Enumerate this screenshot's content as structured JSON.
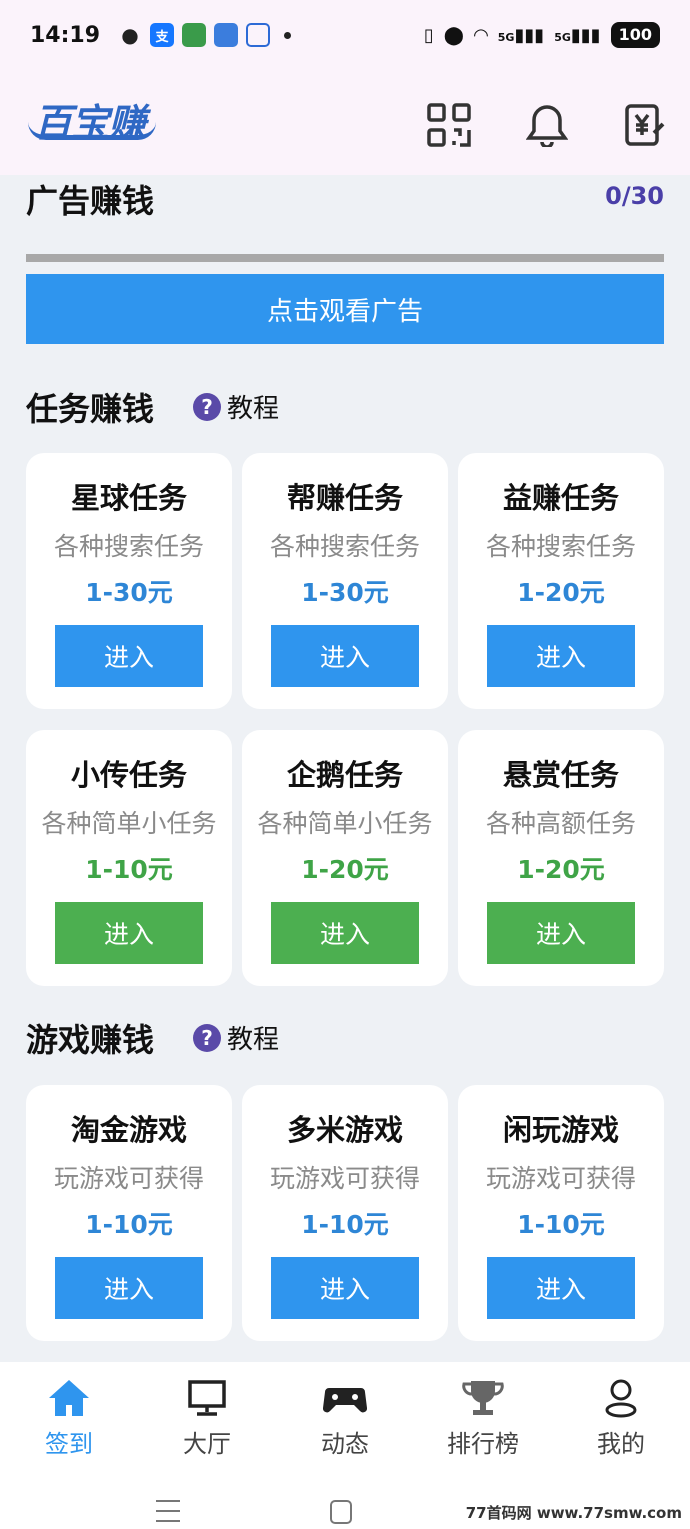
{
  "status_bar": {
    "time": "14:19",
    "notifications": [
      {
        "name": "wechat-icon",
        "glyph": "●",
        "color": "#222222"
      },
      {
        "name": "alipay-icon",
        "glyph": "支",
        "color": "#1677ff"
      },
      {
        "name": "app-icon",
        "glyph": "▣",
        "color": "#3a9b4a"
      },
      {
        "name": "message-icon",
        "glyph": "▪",
        "color": "#3b7ddd"
      },
      {
        "name": "vpn-icon",
        "glyph": "◠",
        "color": "#2d6ad6"
      }
    ],
    "signal_1": "5G",
    "signal_2": "5G",
    "battery": "100"
  },
  "header": {
    "logo_text": "百宝赚",
    "icons": [
      "qr-code-icon",
      "bell-icon",
      "wallet-icon"
    ]
  },
  "ad_section": {
    "title": "广告赚钱",
    "counter": "0/30",
    "progress": 0,
    "button_label": "点击观看广告"
  },
  "task_section": {
    "title": "任务赚钱",
    "tutorial_label": "教程",
    "tutorial_icon": "?",
    "cards": [
      {
        "title": "星球任务",
        "subtitle": "各种搜索任务",
        "reward": "1-30元",
        "button": "进入",
        "theme": "blue"
      },
      {
        "title": "帮赚任务",
        "subtitle": "各种搜索任务",
        "reward": "1-30元",
        "button": "进入",
        "theme": "blue"
      },
      {
        "title": "益赚任务",
        "subtitle": "各种搜索任务",
        "reward": "1-20元",
        "button": "进入",
        "theme": "blue"
      },
      {
        "title": "小传任务",
        "subtitle": "各种简单小任务",
        "reward": "1-10元",
        "button": "进入",
        "theme": "green"
      },
      {
        "title": "企鹅任务",
        "subtitle": "各种简单小任务",
        "reward": "1-20元",
        "button": "进入",
        "theme": "green"
      },
      {
        "title": "悬赏任务",
        "subtitle": "各种高额任务",
        "reward": "1-20元",
        "button": "进入",
        "theme": "green"
      }
    ]
  },
  "game_section": {
    "title": "游戏赚钱",
    "tutorial_label": "教程",
    "tutorial_icon": "?",
    "cards": [
      {
        "title": "淘金游戏",
        "subtitle": "玩游戏可获得",
        "reward": "1-10元",
        "button": "进入",
        "theme": "blue"
      },
      {
        "title": "多米游戏",
        "subtitle": "玩游戏可获得",
        "reward": "1-10元",
        "button": "进入",
        "theme": "blue"
      },
      {
        "title": "闲玩游戏",
        "subtitle": "玩游戏可获得",
        "reward": "1-10元",
        "button": "进入",
        "theme": "blue"
      }
    ]
  },
  "bottom_nav": {
    "items": [
      {
        "label": "签到",
        "icon": "home-icon",
        "active": true
      },
      {
        "label": "大厅",
        "icon": "monitor-icon",
        "active": false
      },
      {
        "label": "动态",
        "icon": "gamepad-icon",
        "active": false
      },
      {
        "label": "排行榜",
        "icon": "trophy-icon",
        "active": false
      },
      {
        "label": "我的",
        "icon": "user-icon",
        "active": false
      }
    ]
  },
  "watermark": "77首码网 www.77smw.com",
  "colors": {
    "primary_blue": "#2f95ee",
    "green": "#4caf50",
    "reward_blue": "#2e86d6",
    "reward_green": "#3fa447",
    "purple": "#4a3fa8"
  }
}
